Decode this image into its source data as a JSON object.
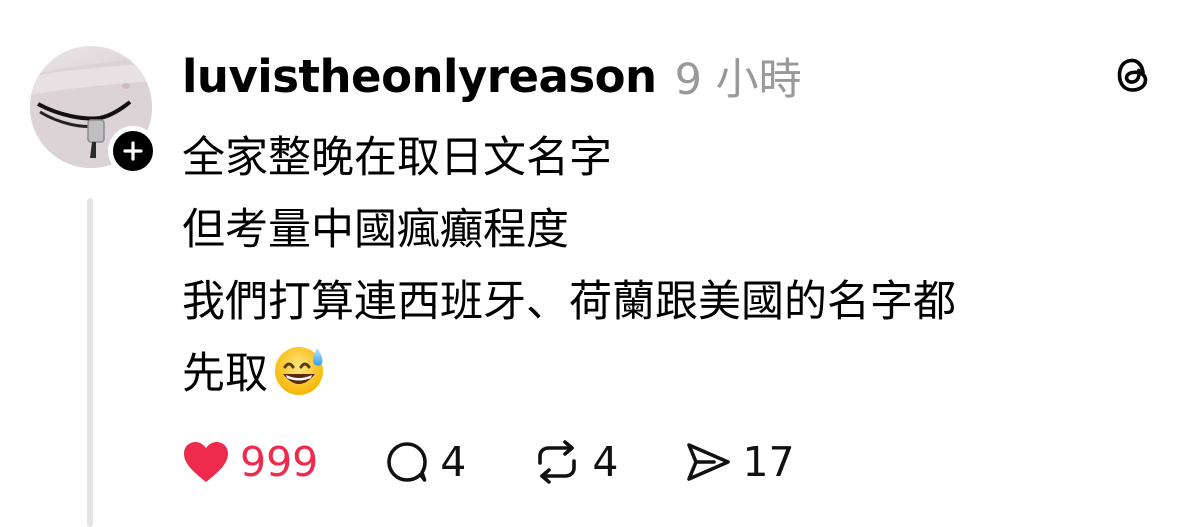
{
  "post": {
    "username": "luvistheonlyreason",
    "timestamp": "9 小時",
    "lines": [
      "全家整晚在取日文名字",
      "但考量中國瘋癲程度",
      "我們打算連西班牙、荷蘭跟美國的名字都",
      "先取"
    ],
    "trailing_emoji": "grinning-face-with-sweat-emoji"
  },
  "actions": {
    "likes": "999",
    "comments": "4",
    "reposts": "4",
    "shares": "17"
  },
  "colors": {
    "like_red": "#ee2a4d",
    "timestamp_gray": "#999999",
    "thread_line": "#e4e4e4"
  },
  "icons": {
    "logo": "threads-logo-icon",
    "follow": "plus-icon",
    "like": "heart-filled-icon",
    "comment": "speech-bubble-icon",
    "repost": "repost-arrows-icon",
    "share": "send-arrow-icon"
  }
}
